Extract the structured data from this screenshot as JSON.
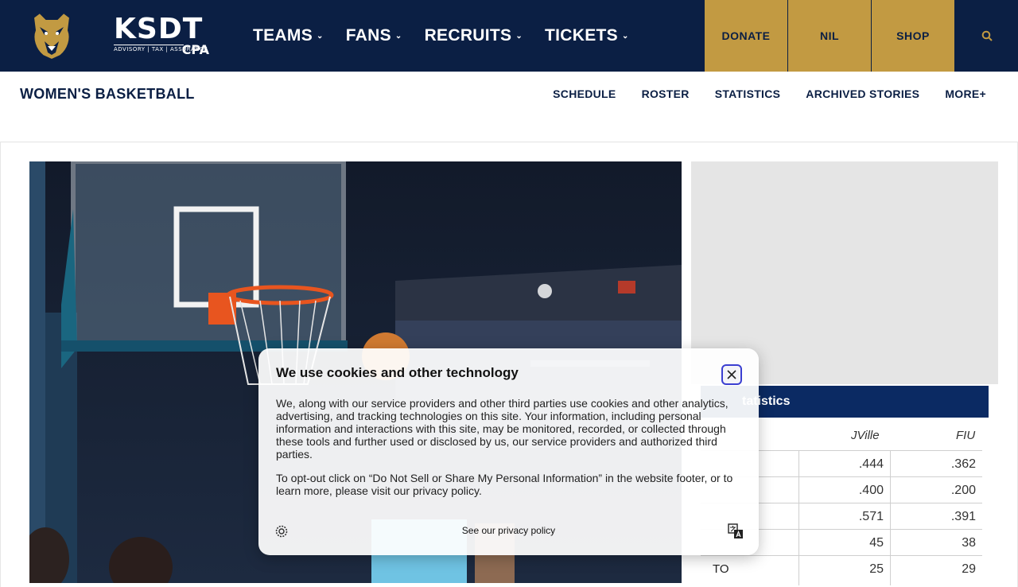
{
  "sponsor": {
    "name": "KSDT",
    "tagline": "ADVISORY | TAX | ASSURANCE",
    "suffix": "CPA"
  },
  "main_nav": [
    {
      "label": "TEAMS"
    },
    {
      "label": "FANS"
    },
    {
      "label": "RECRUITS"
    },
    {
      "label": "TICKETS"
    }
  ],
  "actions": {
    "donate": "DONATE",
    "nil": "NIL",
    "shop": "SHOP"
  },
  "sport": {
    "title": "WOMEN'S BASKETBALL"
  },
  "sub_nav": [
    {
      "label": "SCHEDULE"
    },
    {
      "label": "ROSTER"
    },
    {
      "label": "STATISTICS"
    },
    {
      "label": "ARCHIVED STORIES"
    },
    {
      "label": "MORE+"
    }
  ],
  "stats": {
    "title": "Statistics",
    "title_visible": "tatistics",
    "columns": [
      "JVille",
      "FIU"
    ],
    "rows": [
      {
        "label": "",
        "a": ".444",
        "b": ".362"
      },
      {
        "label": "",
        "a": ".400",
        "b": ".200"
      },
      {
        "label": "",
        "a": ".571",
        "b": ".391"
      },
      {
        "label": "",
        "a": "45",
        "b": "38"
      },
      {
        "label": "TO",
        "a": "25",
        "b": "29"
      }
    ]
  },
  "cookie": {
    "title": "We use cookies and other technology",
    "body": "We, along with our service providers and other third parties use cookies and other analytics, advertising, and tracking technologies on this site. Your information, including personal information and interactions with this site, may be monitored, recorded, or collected through these tools and further used or disclosed by us, our service providers and authorized third parties.",
    "optout": "To opt-out click on “Do Not Sell or Share My Personal Information” in the website footer, or to learn more, please visit our privacy policy.",
    "privacy_link": "See our privacy policy"
  },
  "colors": {
    "navy": "#0b1f44",
    "gold": "#c29a42",
    "stats_header": "#0b2a63"
  }
}
